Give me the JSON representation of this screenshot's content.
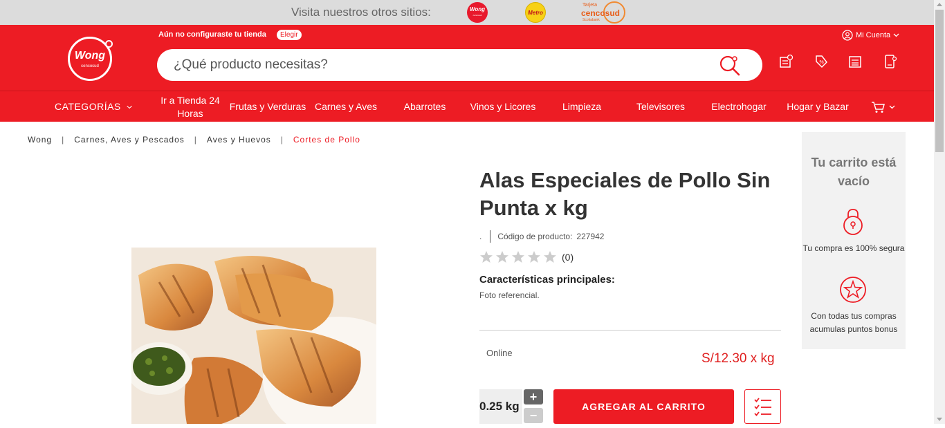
{
  "topbar": {
    "visit_text": "Visita nuestros otros sitios:",
    "sites": [
      {
        "name": "Wong",
        "sub": "cencosud"
      },
      {
        "name": "Metro"
      },
      {
        "name": "cencosud",
        "pre": "Tarjeta",
        "post": "Scotiabank"
      }
    ]
  },
  "header": {
    "brand": "Wong",
    "brand_sub": "cencosud",
    "store_msg": "Aún no configuraste tu tienda",
    "store_btn": "Elegir",
    "search_placeholder": "¿Qué producto necesitas?",
    "account_label": "Mi Cuenta",
    "colors": {
      "primary": "#ed1c24"
    }
  },
  "nav": {
    "categories_label": "CATEGORÍAS",
    "items": [
      "Ir a Tienda 24 Horas",
      "Frutas y Verduras",
      "Carnes y Aves",
      "Abarrotes",
      "Vinos y Licores",
      "Limpieza",
      "Televisores",
      "Electrohogar",
      "Hogar y Bazar"
    ]
  },
  "breadcrumb": [
    "Wong",
    "Carnes, Aves y Pescados",
    "Aves y Huevos",
    "Cortes de Pollo"
  ],
  "product": {
    "title": "Alas Especiales de Pollo Sin Punta x kg",
    "brand": ".",
    "code_label": "Código de producto:",
    "code": "227942",
    "rating_count": "(0)",
    "features_heading": "Características principales:",
    "features_text": "Foto referencial.",
    "channel": "Online",
    "price": "S/12.30 x kg",
    "quantity": "0.25 kg",
    "plus": "+",
    "minus": "−",
    "add_label": "AGREGAR AL CARRITO"
  },
  "cart": {
    "empty_title": "Tu carrito está vacío",
    "secure_text": "Tu compra es 100% segura",
    "bonus_text": "Con todas tus compras acumulas puntos bonus"
  }
}
